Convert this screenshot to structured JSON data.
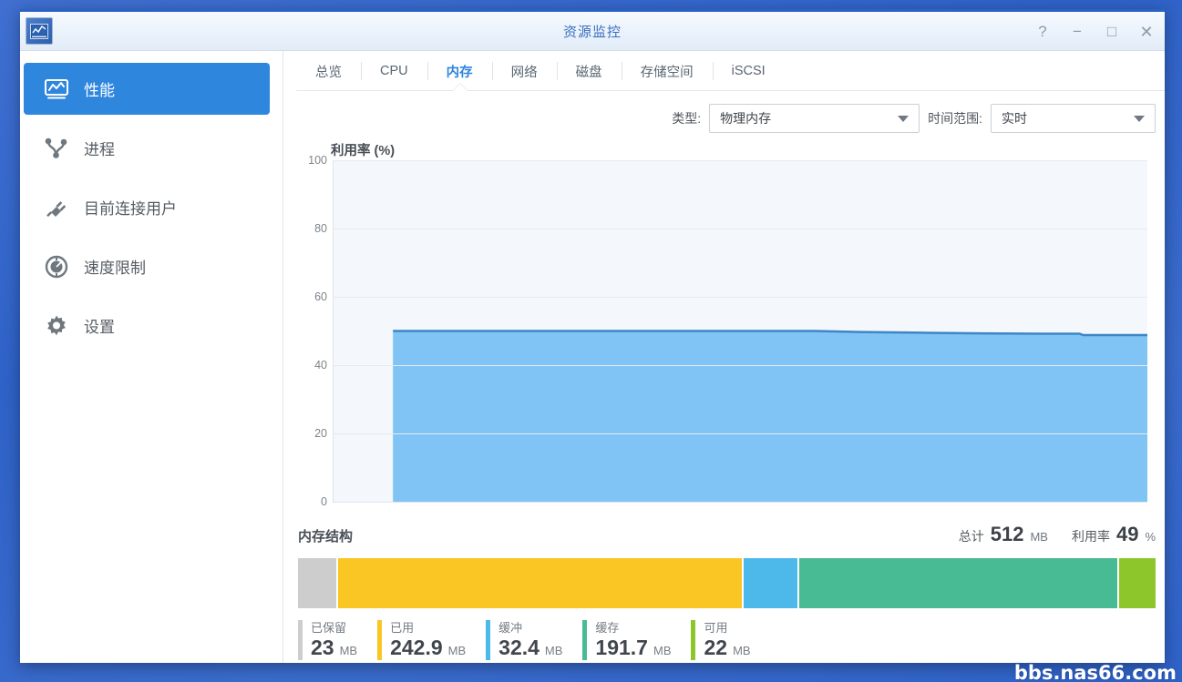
{
  "window": {
    "title": "资源监控",
    "app_icon": "chart-monitor-icon",
    "buttons": {
      "help": "?",
      "minimize": "−",
      "maximize": "□",
      "close": "✕"
    }
  },
  "sidebar": {
    "items": [
      {
        "label": "性能",
        "icon": "performance-chart-icon",
        "active": true
      },
      {
        "label": "进程",
        "icon": "process-network-icon",
        "active": false
      },
      {
        "label": "目前连接用户",
        "icon": "plug-connection-icon",
        "active": false
      },
      {
        "label": "速度限制",
        "icon": "speed-gauge-icon",
        "active": false
      },
      {
        "label": "设置",
        "icon": "gear-icon",
        "active": false
      }
    ]
  },
  "tabs": [
    {
      "label": "总览",
      "active": false
    },
    {
      "label": "CPU",
      "active": false
    },
    {
      "label": "内存",
      "active": true
    },
    {
      "label": "网络",
      "active": false
    },
    {
      "label": "磁盘",
      "active": false
    },
    {
      "label": "存储空间",
      "active": false
    },
    {
      "label": "iSCSI",
      "active": false
    }
  ],
  "controls": {
    "type_label": "类型:",
    "type_value": "物理内存",
    "range_label": "时间范围:",
    "range_value": "实时",
    "caret_icon": "chevron-down-icon"
  },
  "memory_structure": {
    "title": "内存结构",
    "total": {
      "label": "总计",
      "value": "512",
      "unit": "MB"
    },
    "utilization": {
      "label": "利用率",
      "value": "49",
      "unit": "%"
    },
    "segments": [
      {
        "name": "已保留",
        "value": "23",
        "unit": "MB",
        "color": "#cdcdcd",
        "mb": 23
      },
      {
        "name": "已用",
        "value": "242.9",
        "unit": "MB",
        "color": "#f9c623",
        "mb": 242.9
      },
      {
        "name": "缓冲",
        "value": "32.4",
        "unit": "MB",
        "color": "#4db8ea",
        "mb": 32.4
      },
      {
        "name": "缓存",
        "value": "191.7",
        "unit": "MB",
        "color": "#48bb94",
        "mb": 191.7
      },
      {
        "name": "可用",
        "value": "22",
        "unit": "MB",
        "color": "#8cc62b",
        "mb": 22
      }
    ]
  },
  "watermark": "bbs.nas66.com",
  "chart_data": {
    "type": "area",
    "title": "利用率 (%)",
    "xlabel": "",
    "ylabel": "利用率 (%)",
    "ylim": [
      0,
      100
    ],
    "yticks": [
      0,
      20,
      40,
      60,
      80,
      100
    ],
    "grid": true,
    "legend": "none",
    "series": [
      {
        "name": "物理内存利用率",
        "line_color": "#3d86c6",
        "fill_color": "#7fc4f5",
        "x": [
          0.0,
          0.08,
          0.2,
          0.35,
          0.48,
          0.56,
          0.62,
          0.7,
          0.78,
          0.86,
          0.91,
          0.915,
          0.96,
          1.0
        ],
        "values": [
          50,
          50,
          50,
          50,
          50,
          50,
          49.7,
          49.5,
          49.3,
          49.2,
          49.2,
          48.8,
          48.8,
          48.8
        ],
        "data_start_fraction": 0.073
      }
    ]
  }
}
